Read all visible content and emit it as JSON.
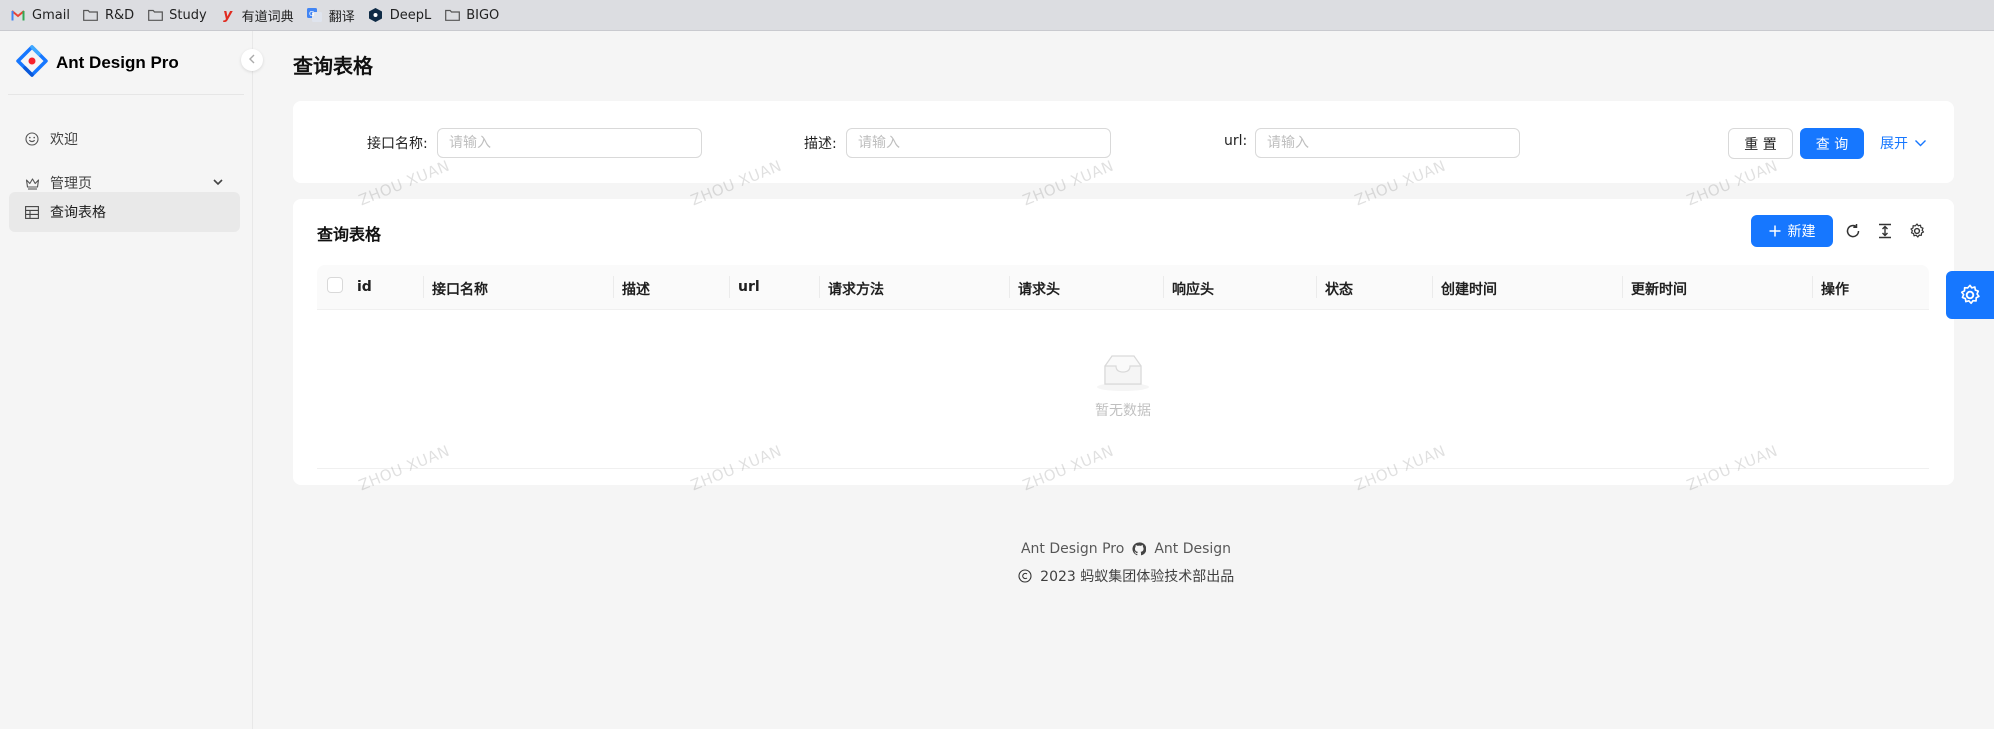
{
  "bookmarks": [
    {
      "label": "Gmail",
      "icon": "gmail-icon"
    },
    {
      "label": "R&D",
      "icon": "folder-icon"
    },
    {
      "label": "Study",
      "icon": "folder-icon"
    },
    {
      "label": "有道词典",
      "icon": "youdao-icon"
    },
    {
      "label": "翻译",
      "icon": "translate-icon"
    },
    {
      "label": "DeepL",
      "icon": "deepl-icon"
    },
    {
      "label": "BIGO",
      "icon": "folder-icon"
    }
  ],
  "sidebar": {
    "app_title": "Ant Design Pro",
    "items": [
      {
        "label": "欢迎",
        "icon": "smile-icon"
      },
      {
        "label": "管理页",
        "icon": "crown-icon"
      },
      {
        "label": "查询表格",
        "icon": "table-icon"
      }
    ]
  },
  "page": {
    "title": "查询表格"
  },
  "search_form": {
    "fields": [
      {
        "label": "接口名称:",
        "placeholder": "请输入",
        "value": ""
      },
      {
        "label": "描述:",
        "placeholder": "请输入",
        "value": ""
      },
      {
        "label": "url:",
        "placeholder": "请输入",
        "value": ""
      }
    ],
    "reset_label": "重 置",
    "query_label": "查 询",
    "expand_label": "展开"
  },
  "table": {
    "title": "查询表格",
    "new_label": "新建",
    "columns": [
      "id",
      "接口名称",
      "描述",
      "url",
      "请求方法",
      "请求头",
      "响应头",
      "状态",
      "创建时间",
      "更新时间",
      "操作"
    ],
    "empty_text": "暂无数据"
  },
  "watermark": "ZHOU XUAN",
  "footer": {
    "links": [
      "Ant Design Pro",
      "Ant Design"
    ],
    "copyright": "2023 蚂蚁集团体验技术部出品"
  },
  "colors": {
    "primary": "#1677ff",
    "background": "#f5f5f5"
  }
}
